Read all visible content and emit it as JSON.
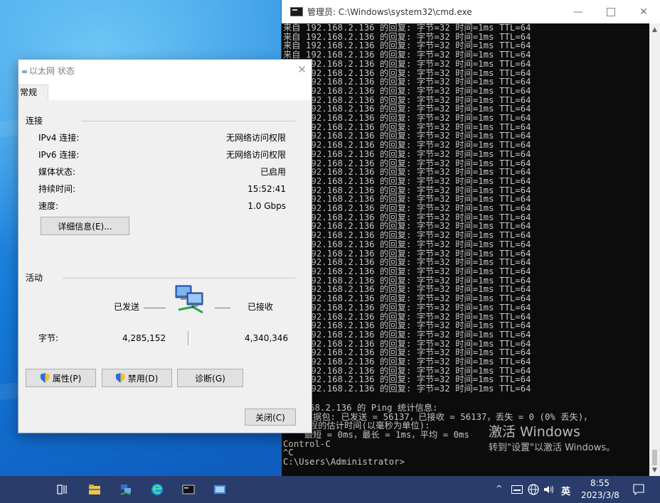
{
  "cmd": {
    "title": "管理员: C:\\Windows\\system32\\cmd.exe",
    "controls": {
      "minimize": "—",
      "close": "✕"
    },
    "lines": [
      "来自 192.168.2.136 的回复: 字节=32 时间=1ms TTL=64",
      "来自 192.168.2.136 的回复: 字节=32 时间=1ms TTL=64",
      "来自 192.168.2.136 的回复: 字节=32 时间=1ms TTL=64",
      "来自 192.168.2.136 的回复: 字节=32 时间=1ms TTL=64",
      "来自 192.168.2.136 的回复: 字节=32 时间=1ms TTL=64",
      "来自 192.168.2.136 的回复: 字节=32 时间=1ms TTL=64",
      "来自 192.168.2.136 的回复: 字节=32 时间=1ms TTL=64",
      "来自 192.168.2.136 的回复: 字节=32 时间=1ms TTL=64",
      "来自 192.168.2.136 的回复: 字节=32 时间=1ms TTL=64",
      "来自 192.168.2.136 的回复: 字节=32 时间=1ms TTL=64",
      "来自 192.168.2.136 的回复: 字节=32 时间=1ms TTL=64",
      "来自 192.168.2.136 的回复: 字节=32 时间=1ms TTL=64",
      "来自 192.168.2.136 的回复: 字节=32 时间=1ms TTL=64",
      "来自 192.168.2.136 的回复: 字节=32 时间=1ms TTL=64",
      "来自 192.168.2.136 的回复: 字节=32 时间=1ms TTL=64",
      "来自 192.168.2.136 的回复: 字节=32 时间=1ms TTL=64",
      "来自 192.168.2.136 的回复: 字节=32 时间=1ms TTL=64",
      "来自 192.168.2.136 的回复: 字节=32 时间=1ms TTL=64",
      "来自 192.168.2.136 的回复: 字节=32 时间=1ms TTL=64",
      "来自 192.168.2.136 的回复: 字节=32 时间=1ms TTL=64",
      "来自 192.168.2.136 的回复: 字节=32 时间=1ms TTL=64",
      "来自 192.168.2.136 的回复: 字节=32 时间=1ms TTL=64",
      "来自 192.168.2.136 的回复: 字节=32 时间=1ms TTL=64",
      "来自 192.168.2.136 的回复: 字节=32 时间=1ms TTL=64",
      "来自 192.168.2.136 的回复: 字节=32 时间=1ms TTL=64",
      "来自 192.168.2.136 的回复: 字节=32 时间=1ms TTL=64",
      "来自 192.168.2.136 的回复: 字节=32 时间=1ms TTL=64",
      "来自 192.168.2.136 的回复: 字节=32 时间=1ms TTL=64",
      "来自 192.168.2.136 的回复: 字节=32 时间=1ms TTL=64",
      "来自 192.168.2.136 的回复: 字节=32 时间=1ms TTL=64",
      "来自 192.168.2.136 的回复: 字节=32 时间=1ms TTL=64",
      "来自 192.168.2.136 的回复: 字节=32 时间=1ms TTL=64",
      "来自 192.168.2.136 的回复: 字节=32 时间=1ms TTL=64",
      "来自 192.168.2.136 的回复: 字节=32 时间=1ms TTL=64",
      "来自 192.168.2.136 的回复: 字节=32 时间=1ms TTL=64",
      "来自 192.168.2.136 的回复: 字节=32 时间=1ms TTL=64",
      "来自 192.168.2.136 的回复: 字节=32 时间=1ms TTL=64",
      "来自 192.168.2.136 的回复: 字节=32 时间=1ms TTL=64",
      "来自 192.168.2.136 的回复: 字节=32 时间=1ms TTL=64",
      "来自 192.168.2.136 的回复: 字节=32 时间=1ms TTL=64",
      "来自 192.168.2.136 的回复: 字节=32 时间=1ms TTL=64"
    ],
    "summary": [
      "192.168.2.136 的 Ping 统计信息:",
      "    数据包: 已发送 = 56137，已接收 = 56137，丢失 = 0 (0% 丢失)，",
      "往返行程的估计时间(以毫秒为单位):",
      "    最短 = 0ms，最长 = 1ms，平均 = 0ms",
      "Control-C",
      "^C",
      "C:\\Users\\Administrator>"
    ],
    "watermark_line1": "激活 Windows",
    "watermark_line2": "转到\"设置\"以激活 Windows。"
  },
  "dialog": {
    "title": "以太网 状态",
    "close_glyph": "✕",
    "tab_general": "常规",
    "connection_group": "连接",
    "rows": [
      {
        "label": "IPv4 连接:",
        "value": "无网络访问权限"
      },
      {
        "label": "IPv6 连接:",
        "value": "无网络访问权限"
      },
      {
        "label": "媒体状态:",
        "value": "已启用"
      },
      {
        "label": "持续时间:",
        "value": "15:52:41"
      },
      {
        "label": "速度:",
        "value": "1.0 Gbps"
      }
    ],
    "details_button": "详细信息(E)...",
    "activity_group": "活动",
    "sent_label": "已发送",
    "received_label": "已接收",
    "bytes_label": "字节:",
    "bytes_sent": "4,285,152",
    "bytes_received": "4,340,346",
    "properties_button": "属性(P)",
    "disable_button": "禁用(D)",
    "diagnose_button": "诊断(G)",
    "close_button": "关闭(C)"
  },
  "taskbar": {
    "ime": "英",
    "time": "8:55",
    "date": "2023/3/8"
  }
}
